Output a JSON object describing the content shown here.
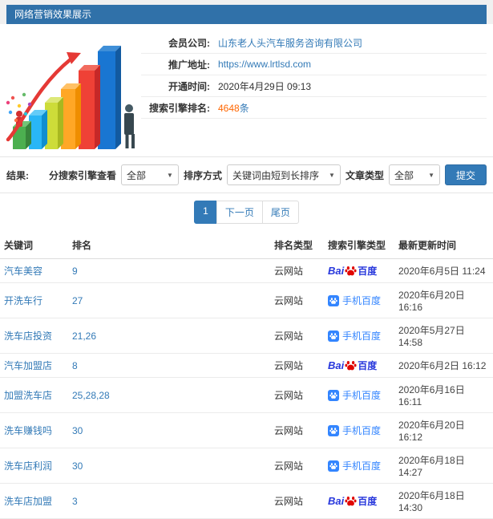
{
  "header": {
    "title": "网络营销效果展示"
  },
  "info": {
    "rows": [
      {
        "label": "会员公司:",
        "value": "山东老人头汽车服务咨询有限公司"
      },
      {
        "label": "推广地址:",
        "value": "https://www.lrtlsd.com"
      },
      {
        "label": "开通时间:",
        "value": "2020年4月29日 09:13"
      },
      {
        "label": "搜索引擎排名:",
        "value": "4648",
        "suffix": "条"
      }
    ]
  },
  "filters": {
    "section_label": "结果:",
    "engine_filter_label": "分搜索引擎查看",
    "engine_filter_value": "全部",
    "sort_label": "排序方式",
    "sort_value": "关键词由短到长排序",
    "article_type_label": "文章类型",
    "article_type_value": "全部",
    "submit_label": "提交"
  },
  "pagination": {
    "current_page": "1",
    "next_label": "下一页",
    "last_label": "尾页"
  },
  "table": {
    "headers": [
      "关键词",
      "排名",
      "排名类型",
      "搜索引擎类型",
      "最新更新时间"
    ],
    "engine_labels": {
      "baidu_prefix": "Bai",
      "baidu_suffix": "百度",
      "mobile_baidu": "手机百度"
    },
    "rows": [
      {
        "keyword": "汽车美容",
        "rank": "9",
        "rank_type": "云网站",
        "engine": "baidu",
        "time": "2020年6月5日 11:24"
      },
      {
        "keyword": "开洗车行",
        "rank": "27",
        "rank_type": "云网站",
        "engine": "mobile",
        "time": "2020年6月20日 16:16"
      },
      {
        "keyword": "洗车店投资",
        "rank": "21,26",
        "rank_type": "云网站",
        "engine": "mobile",
        "time": "2020年5月27日 14:58"
      },
      {
        "keyword": "汽车加盟店",
        "rank": "8",
        "rank_type": "云网站",
        "engine": "baidu",
        "time": "2020年6月2日 16:12"
      },
      {
        "keyword": "加盟洗车店",
        "rank": "25,28,28",
        "rank_type": "云网站",
        "engine": "mobile",
        "time": "2020年6月16日 16:11"
      },
      {
        "keyword": "洗车赚钱吗",
        "rank": "30",
        "rank_type": "云网站",
        "engine": "mobile",
        "time": "2020年6月20日 16:12"
      },
      {
        "keyword": "洗车店利润",
        "rank": "30",
        "rank_type": "云网站",
        "engine": "mobile",
        "time": "2020年6月18日 14:27"
      },
      {
        "keyword": "洗车店加盟",
        "rank": "3",
        "rank_type": "云网站",
        "engine": "baidu",
        "time": "2020年6月18日 14:30"
      }
    ]
  },
  "colors": {
    "header_bar_blue": "#3071a9",
    "link_blue": "#337ab7",
    "rank_count_orange": "#ff6600",
    "baidu_text_blue": "#2636dc",
    "baidu_paw_red": "#e10601",
    "mobile_baidu_blue": "#3385ff"
  }
}
